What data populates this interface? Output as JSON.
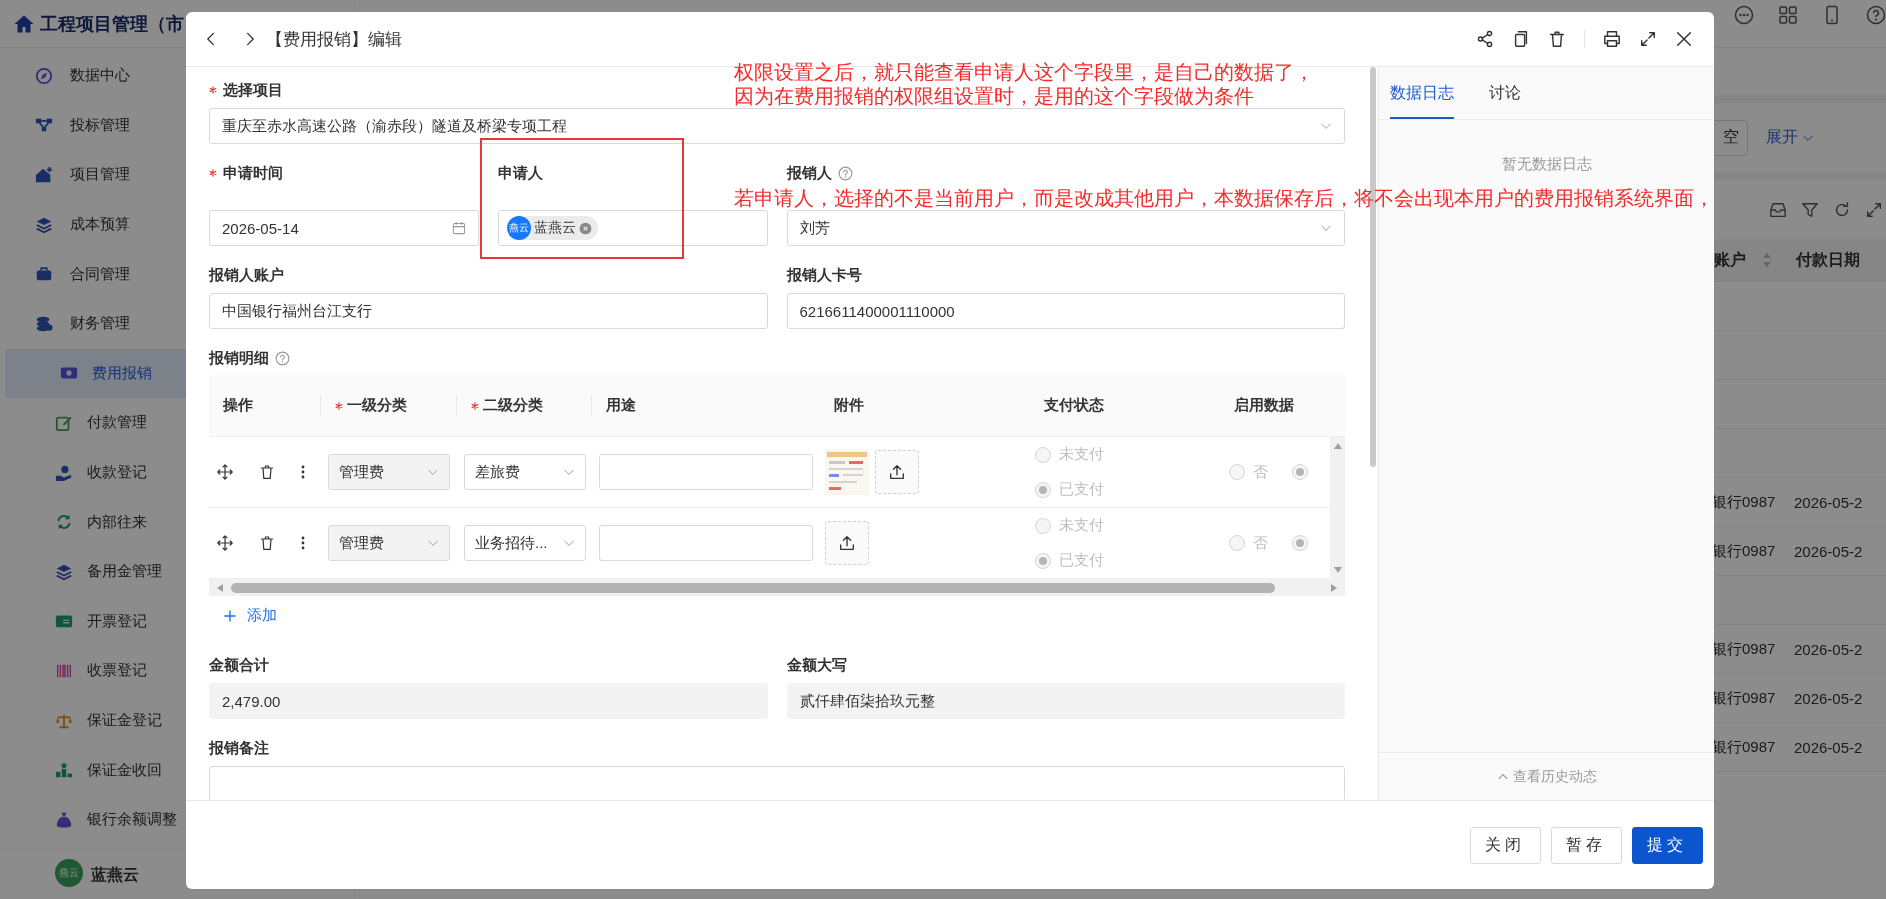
{
  "app": {
    "title": "工程项目管理（市"
  },
  "sidebar": {
    "items": [
      {
        "label": "数据中心",
        "selected": false
      },
      {
        "label": "投标管理",
        "selected": false
      },
      {
        "label": "项目管理",
        "selected": false
      },
      {
        "label": "成本预算",
        "selected": false
      },
      {
        "label": "合同管理",
        "selected": false
      },
      {
        "label": "财务管理",
        "selected": false,
        "expanded": true,
        "children": [
          {
            "label": "费用报销",
            "selected": true
          },
          {
            "label": "付款管理",
            "selected": false
          },
          {
            "label": "收款登记",
            "selected": false
          },
          {
            "label": "内部往来",
            "selected": false
          },
          {
            "label": "备用金管理",
            "selected": false
          },
          {
            "label": "开票登记",
            "selected": false
          },
          {
            "label": "收票登记",
            "selected": false
          },
          {
            "label": "保证金登记",
            "selected": false
          },
          {
            "label": "保证金收回",
            "selected": false
          },
          {
            "label": "银行余额调整",
            "selected": false
          }
        ]
      }
    ]
  },
  "user": {
    "avatar": "燕云",
    "name": "蓝燕云"
  },
  "filter_bar": {
    "reset_button": "空",
    "expand_link": "展开"
  },
  "list_table": {
    "columns": [
      "账户",
      "付款日期"
    ],
    "rows": [
      {},
      {},
      {},
      {},
      {
        "cells": [
          "银行0987",
          "2026-05-2"
        ]
      },
      {
        "cells": [
          "银行0987",
          "2026-05-2"
        ]
      },
      {},
      {
        "cells": [
          "银行0987",
          "2026-05-2"
        ]
      },
      {
        "cells": [
          "银行0987",
          "2026-05-2"
        ]
      },
      {
        "cells": [
          "银行0987",
          "2026-05-2"
        ]
      }
    ]
  },
  "dialog": {
    "title": "【费用报销】编辑",
    "form_rows": [
      [
        {
          "label": "选择项目",
          "required": true,
          "help": false,
          "kind": "select",
          "value": "重庆至赤水高速公路（渝赤段）隧道及桥梁专项工程"
        }
      ],
      [
        {
          "label": "申请时间",
          "required": true,
          "help": false,
          "kind": "date",
          "value": "2026-05-14"
        },
        {
          "label": "申请人",
          "required": false,
          "help": false,
          "kind": "user",
          "avatar": "燕云",
          "value": "蓝燕云"
        },
        {
          "label": "报销人",
          "required": false,
          "help": true,
          "kind": "select",
          "value": "刘芳"
        }
      ],
      [
        {
          "label": "报销人账户",
          "required": false,
          "help": false,
          "kind": "text",
          "value": "中国银行福州台江支行"
        },
        {
          "label": "报销人卡号",
          "required": false,
          "help": false,
          "kind": "text",
          "value": "6216611400001110000"
        }
      ]
    ],
    "detail": {
      "label": "报销明细",
      "help": true,
      "columns": [
        {
          "label": "操作",
          "required": false
        },
        {
          "label": "一级分类",
          "required": true
        },
        {
          "label": "二级分类",
          "required": true
        },
        {
          "label": "用途",
          "required": false
        },
        {
          "label": "附件",
          "required": false
        },
        {
          "label": "支付状态",
          "required": false
        },
        {
          "label": "启用数据",
          "required": false
        }
      ],
      "rows": [
        {
          "category": {
            "value": "管理费",
            "disabled": true
          },
          "subcategory": {
            "value": "差旅费",
            "disabled": false
          },
          "has_attachment": true,
          "payment": [
            {
              "label": "未支付",
              "selected": false,
              "disabled": true
            },
            {
              "label": "已支付",
              "selected": true,
              "disabled": true
            }
          ],
          "enabled": [
            {
              "label": "否",
              "selected": false,
              "disabled": true
            },
            {
              "selected": true,
              "disabled": true
            }
          ]
        },
        {
          "category": {
            "value": "管理费",
            "disabled": true
          },
          "subcategory": {
            "value": "业务招待...",
            "disabled": false
          },
          "has_attachment": false,
          "payment": [
            {
              "label": "未支付",
              "selected": false,
              "disabled": true
            },
            {
              "label": "已支付",
              "selected": true,
              "disabled": true
            }
          ],
          "enabled": [
            {
              "label": "否",
              "selected": false,
              "disabled": true
            },
            {
              "selected": true,
              "disabled": true
            }
          ]
        }
      ],
      "add_link": "添加"
    },
    "lower_rows": [
      [
        {
          "label": "金额合计",
          "required": false,
          "help": false,
          "kind": "readonly",
          "value": "2,479.00"
        },
        {
          "label": "金额大写",
          "required": false,
          "help": false,
          "kind": "readonly",
          "value": "贰仟肆佰柒拾玖元整"
        }
      ],
      [
        {
          "label": "报销备注",
          "required": false,
          "help": false,
          "kind": "text"
        }
      ]
    ],
    "log_panel": {
      "tabs": [
        {
          "label": "数据日志",
          "selected": true
        },
        {
          "label": "讨论",
          "selected": false
        }
      ],
      "empty_text": "暂无数据日志",
      "history_link": "查看历史动态"
    },
    "footer": {
      "buttons": [
        {
          "label": "关闭",
          "kind": "default"
        },
        {
          "label": "暂存",
          "kind": "default"
        },
        {
          "label": "提交",
          "kind": "primary"
        }
      ]
    }
  },
  "annotations": {
    "notes": [
      {
        "lines": [
          "权限设置之后，就只能查看申请人这个字段里，是自己的数据了，",
          "因为在费用报销的权限组设置时，是用的这个字段做为条件"
        ]
      },
      {
        "lines": [
          "若申请人，选择的不是当前用户，而是改成其他用户，本数据保存后，将不会出现本用户的费用报销系统界面，"
        ]
      }
    ]
  }
}
